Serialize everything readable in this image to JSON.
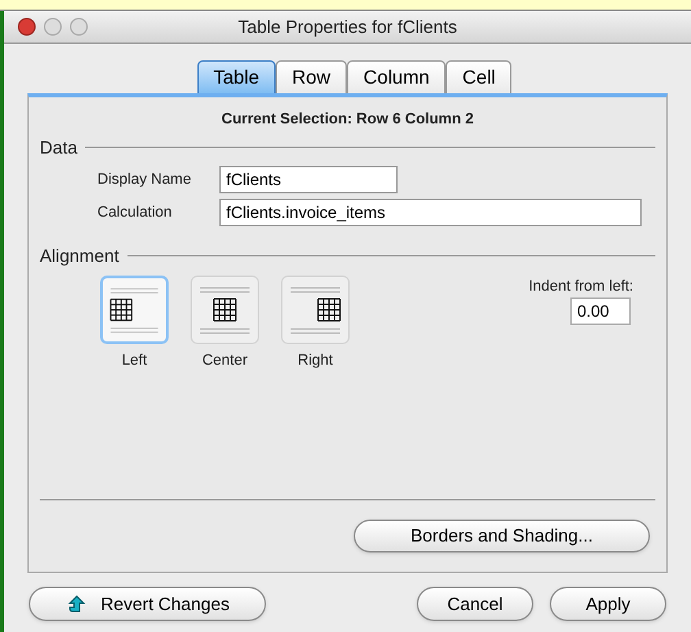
{
  "window": {
    "title": "Table Properties for fClients"
  },
  "tabs": [
    {
      "label": "Table",
      "selected": true
    },
    {
      "label": "Row",
      "selected": false
    },
    {
      "label": "Column",
      "selected": false
    },
    {
      "label": "Cell",
      "selected": false
    }
  ],
  "current_selection": "Current Selection: Row 6 Column 2",
  "data_section": {
    "title": "Data",
    "fields": [
      {
        "label": "Display Name",
        "value": "fClients",
        "kind": "short"
      },
      {
        "label": "Calculation",
        "value": "fClients.invoice_items",
        "kind": "long"
      }
    ]
  },
  "alignment_section": {
    "title": "Alignment",
    "options": [
      {
        "label": "Left",
        "selected": true,
        "kind": "left"
      },
      {
        "label": "Center",
        "selected": false,
        "kind": "center"
      },
      {
        "label": "Right",
        "selected": false,
        "kind": "right"
      }
    ],
    "indent": {
      "label": "Indent from left:",
      "value": "0.00"
    }
  },
  "borders_button": "Borders and Shading...",
  "footer": {
    "revert": "Revert Changes",
    "cancel": "Cancel",
    "apply": "Apply"
  }
}
